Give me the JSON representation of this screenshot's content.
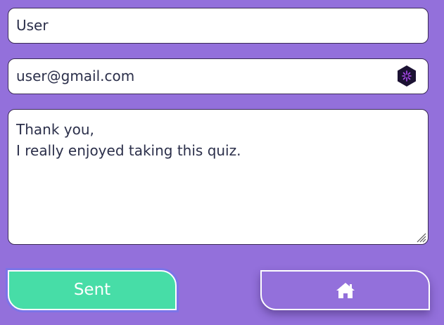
{
  "form": {
    "name_value": "User",
    "email_value": "user@gmail.com",
    "message_lines": [
      "Thank you,",
      "I really enjoyed taking this quiz."
    ]
  },
  "buttons": {
    "sent_label": "Sent",
    "home_icon": "home-icon"
  },
  "icons": {
    "email_extension_icon": "password-manager-icon",
    "resize_grip_icon": "resize-grip-icon"
  },
  "colors": {
    "background": "#9370db",
    "sent_button": "#47dda7",
    "text": "#2b2f4a"
  }
}
